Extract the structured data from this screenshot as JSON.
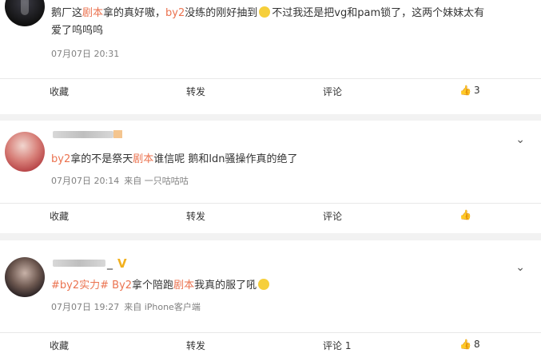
{
  "posts": [
    {
      "text_parts": [
        "鹅厂这",
        "剧本",
        "拿的真好嗷，",
        "by2",
        "没练的刚好抽到",
        "不过我还是把vg和pam锁了，这两个妹妹太有"
      ],
      "text_line2": "爱了呜呜呜",
      "time": "07月07日 20:31",
      "source": "",
      "actions": {
        "favorite": "收藏",
        "repost": "转发",
        "comment": "评论",
        "like_count": "3"
      }
    },
    {
      "text_parts": [
        "by2",
        "拿的不是祭天",
        "剧本",
        "谁信呢 鹅和ldn骚操作真的绝了"
      ],
      "time": "07月07日 20:14",
      "source": "来自 一只咕咕咕",
      "actions": {
        "favorite": "收藏",
        "repost": "转发",
        "comment": "评论",
        "like_count": ""
      }
    },
    {
      "name_suffix": "_",
      "text_parts": [
        "#by2实力#",
        " ",
        "By2",
        "拿个陪跑",
        "剧本",
        "我真的服了吼"
      ],
      "time": "07月07日 19:27",
      "source": "来自 iPhone客户端",
      "actions": {
        "favorite": "收藏",
        "repost": "转发",
        "comment": "评论 1",
        "like_count": "8"
      }
    }
  ],
  "icons": {
    "thumbs_up": "👍",
    "dropdown": "⌄",
    "verified": "V"
  },
  "colors": {
    "highlight": "#eb7350",
    "meta": "#808080",
    "background": "#f2f2f2"
  }
}
